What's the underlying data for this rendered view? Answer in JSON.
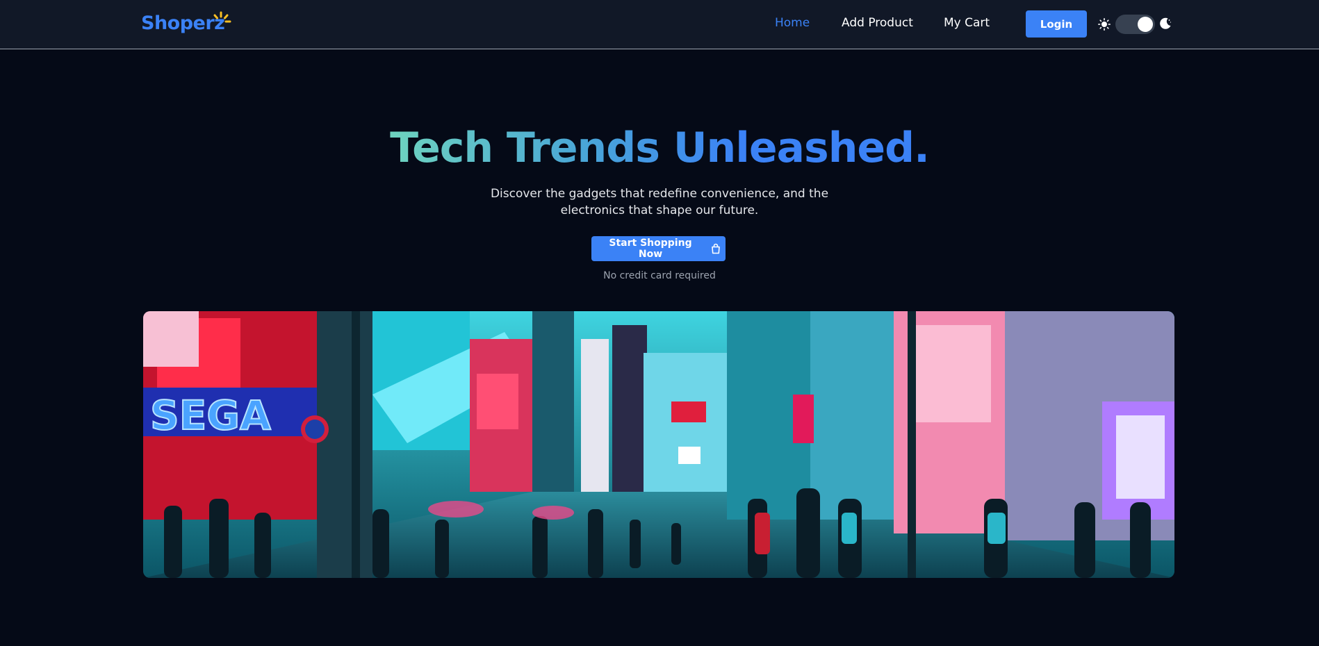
{
  "brand": {
    "name": "Shoperz",
    "accent_color": "#3b82f6",
    "spark_color": "#fbbf24"
  },
  "nav": {
    "links": [
      {
        "label": "Home",
        "active": true
      },
      {
        "label": "Add Product",
        "active": false
      },
      {
        "label": "My Cart",
        "active": false
      }
    ],
    "login_label": "Login",
    "theme_toggle": {
      "state": "dark",
      "left_icon": "sun-icon",
      "right_icon": "moon-icon"
    }
  },
  "hero": {
    "title": "Tech Trends Unleashed.",
    "description": "Discover the gadgets that redefine convenience, and the electronics that shape our future.",
    "cta_label": "Start Shopping Now",
    "cta_icon": "shopping-bag-icon",
    "note": "No credit card required",
    "image_subject": "neon-city-street-photo"
  },
  "colors": {
    "page_background": "#050a17",
    "navbar_background": "#111827",
    "title_gradient_start": "#6ed3bf",
    "title_gradient_end": "#3b82f6"
  }
}
